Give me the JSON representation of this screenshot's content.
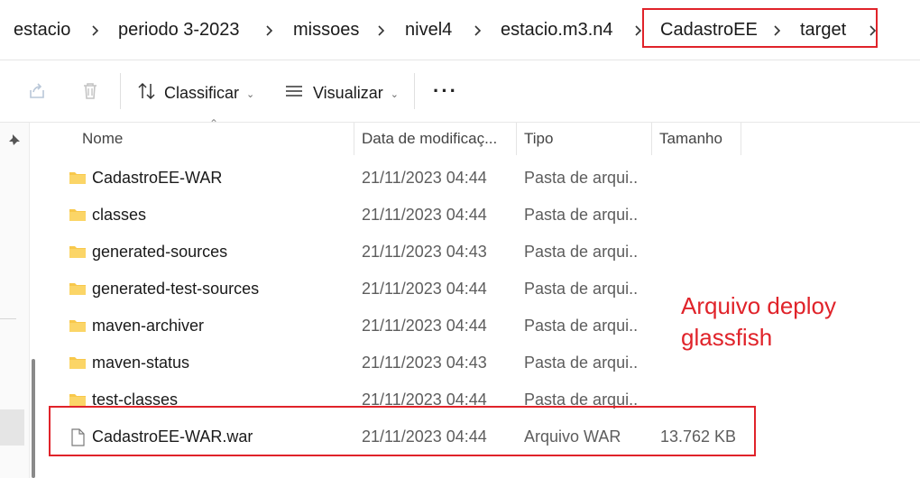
{
  "breadcrumb": {
    "items": [
      "estacio",
      "periodo 3-2023",
      "missoes",
      "nivel4",
      "estacio.m3.n4",
      "CadastroEE",
      "target"
    ]
  },
  "toolbar": {
    "sort_label": "Classificar",
    "view_label": "Visualizar",
    "more_label": "···"
  },
  "columns": {
    "name": "Nome",
    "date": "Data de modificaç...",
    "type": "Tipo",
    "size": "Tamanho"
  },
  "files": [
    {
      "name": "CadastroEE-WAR",
      "date": "21/11/2023 04:44",
      "type": "Pasta de arqui...",
      "size": "",
      "icon": "folder-icon"
    },
    {
      "name": "classes",
      "date": "21/11/2023 04:44",
      "type": "Pasta de arqui...",
      "size": "",
      "icon": "folder-icon"
    },
    {
      "name": "generated-sources",
      "date": "21/11/2023 04:43",
      "type": "Pasta de arqui...",
      "size": "",
      "icon": "folder-icon"
    },
    {
      "name": "generated-test-sources",
      "date": "21/11/2023 04:44",
      "type": "Pasta de arqui...",
      "size": "",
      "icon": "folder-icon"
    },
    {
      "name": "maven-archiver",
      "date": "21/11/2023 04:44",
      "type": "Pasta de arqui...",
      "size": "",
      "icon": "folder-icon"
    },
    {
      "name": "maven-status",
      "date": "21/11/2023 04:43",
      "type": "Pasta de arqui...",
      "size": "",
      "icon": "folder-icon"
    },
    {
      "name": "test-classes",
      "date": "21/11/2023 04:44",
      "type": "Pasta de arqui...",
      "size": "",
      "icon": "folder-icon"
    },
    {
      "name": "CadastroEE-WAR.war",
      "date": "21/11/2023 04:44",
      "type": "Arquivo WAR",
      "size": "13.762 KB",
      "icon": "file-icon"
    }
  ],
  "annotation": {
    "line1": "Arquivo deploy",
    "line2": "glassfish"
  },
  "colors": {
    "annotation_red": "#e0232a",
    "folder_yellow": "#f8c84b"
  }
}
